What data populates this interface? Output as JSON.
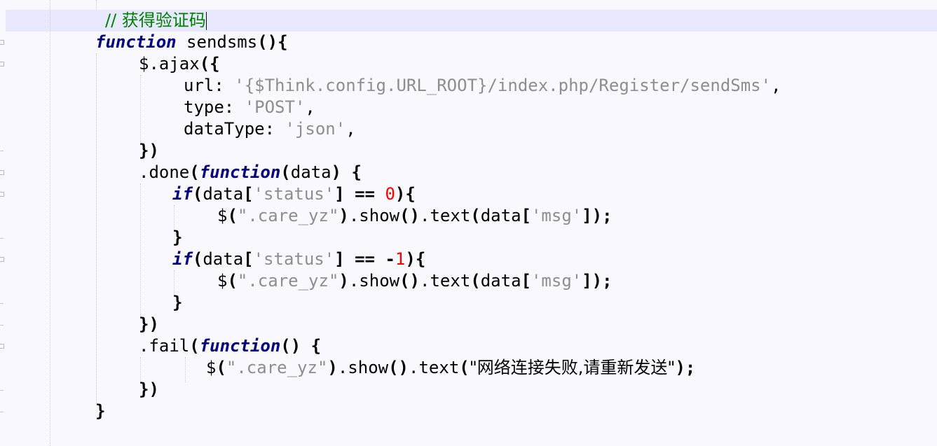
{
  "editor": {
    "comment": "// 获得验证码",
    "func_keyword": "function",
    "func_name": " sendsms",
    "ajax_call": "$.ajax",
    "url_key": "url: ",
    "url_value": "'{$Think.config.URL_ROOT}/index.php/Register/sendSms'",
    "type_key": "type: ",
    "type_value": "'POST'",
    "datatype_key": "dataType: ",
    "datatype_value": "'json'",
    "done_method": ".done",
    "done_param": "data",
    "if_keyword": "if",
    "data_ident": "data",
    "status_str": "'status'",
    "eq_op": "==",
    "zero": "0",
    "minus": "-",
    "one": "1",
    "dollar": "$",
    "selector_str": "\".care_yz\"",
    "show_method": ".show",
    "text_method": ".text",
    "msg_str": "'msg'",
    "fail_method": ".fail",
    "fail_message": "\"网络连接失败,请重新发送\""
  }
}
